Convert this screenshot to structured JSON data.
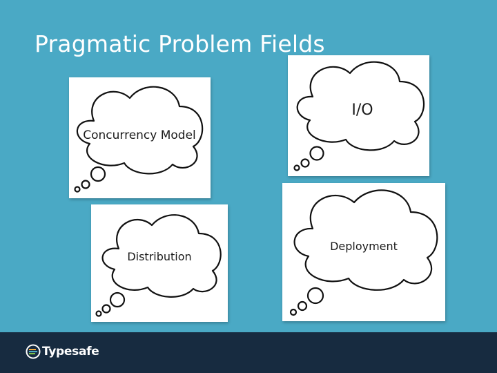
{
  "slide": {
    "title": "Pragmatic Problem Fields",
    "background_color": "#4aa9c5"
  },
  "clouds": [
    {
      "label": "Concurrency Model"
    },
    {
      "label": "I/O"
    },
    {
      "label": "Distribution"
    },
    {
      "label": "Deployment"
    }
  ],
  "footer": {
    "logo_text": "Typesafe",
    "background_color": "#172b40"
  }
}
